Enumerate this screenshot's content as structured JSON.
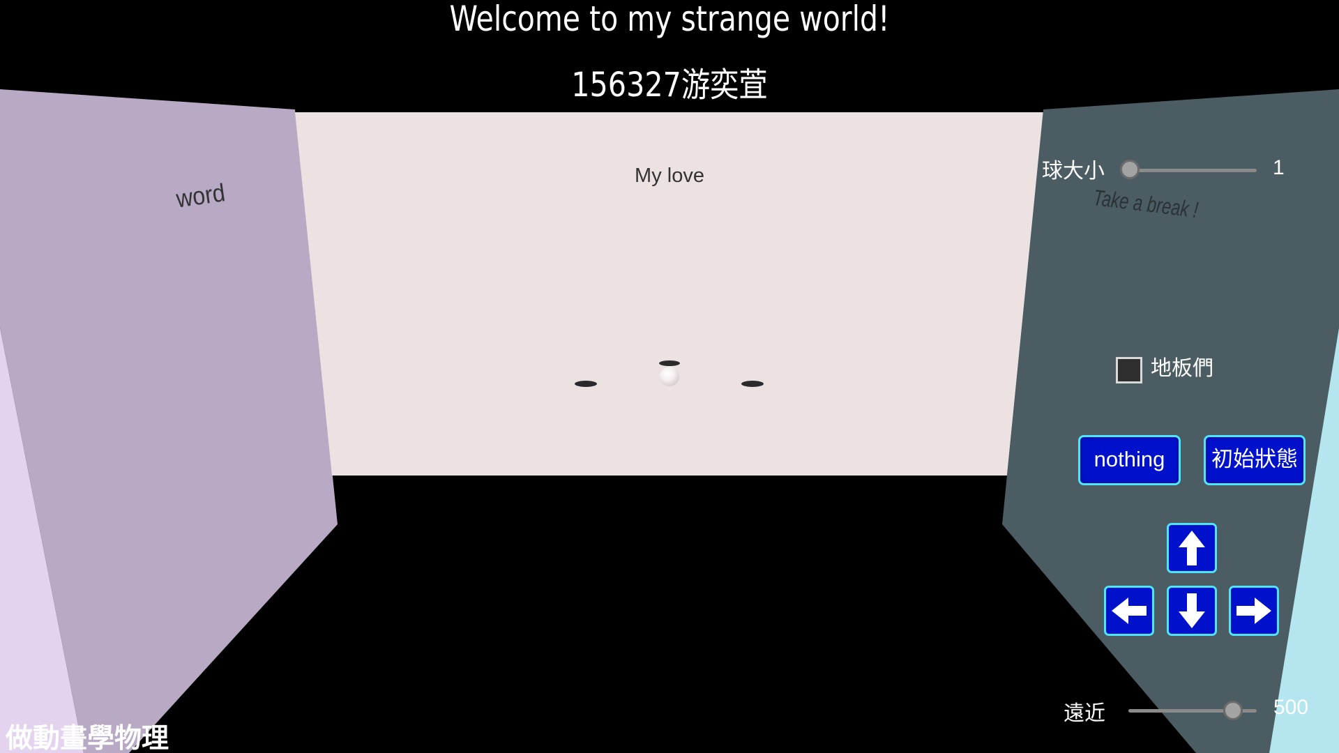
{
  "scene": {
    "title": "Welcome to my strange world!",
    "subtitle": "156327游奕萓",
    "back_wall_text": "My love",
    "left_wall_text": "word",
    "right_wall_text": "Take a break !",
    "colors": {
      "background": "#000000",
      "back_wall": "#ece2e2",
      "left_wall": "#b8a9c5",
      "left_wall_edge": "#e3d3ef",
      "right_wall": "#4b5c62",
      "right_wall_edge": "#b5e5ee"
    }
  },
  "controls": {
    "ball_size": {
      "label": "球大小",
      "value": "1",
      "level": 0.0
    },
    "floors_checkbox": {
      "label": "地板們",
      "checked": false
    },
    "buttons": {
      "nothing": "nothing",
      "reset": "初始狀態"
    },
    "arrows": [
      "up-arrow-icon",
      "left-arrow-icon",
      "down-arrow-icon",
      "right-arrow-icon"
    ],
    "distance": {
      "label": "遠近",
      "value": "500",
      "level": 0.82
    }
  },
  "watermark": "做動畫學物理"
}
